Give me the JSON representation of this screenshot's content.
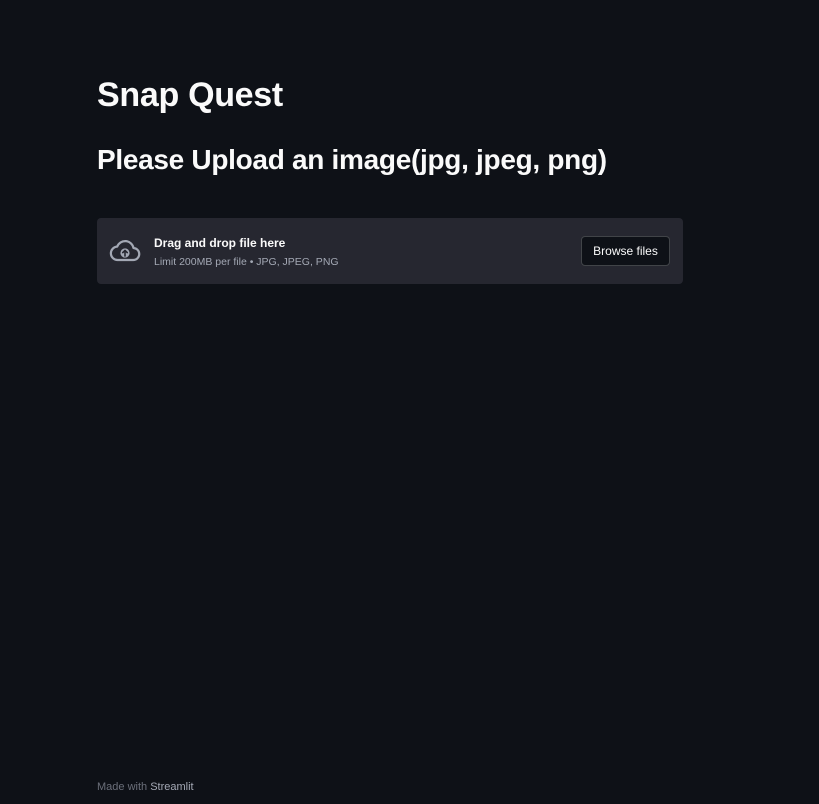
{
  "app": {
    "title": "Snap Quest",
    "subtitle": "Please Upload an image(jpg, jpeg, png)"
  },
  "uploader": {
    "icon": "cloud-upload-icon",
    "main_text": "Drag and drop file here",
    "sub_text": "Limit 200MB per file • JPG, JPEG, PNG",
    "button_label": "Browse files"
  },
  "footer": {
    "prefix": "Made with",
    "link_text": "Streamlit"
  },
  "colors": {
    "background": "#0e1117",
    "dropzone": "#262730",
    "text": "#fafafa",
    "muted": "#a3a8b4"
  }
}
